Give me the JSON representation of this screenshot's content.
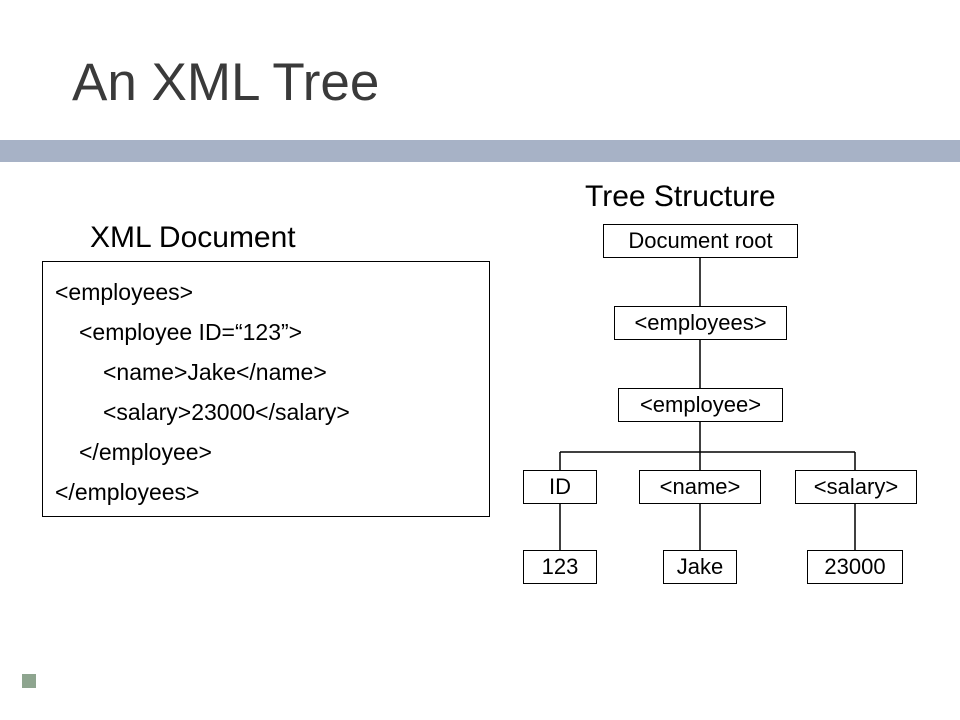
{
  "title": "An XML Tree",
  "left_heading": "XML Document",
  "right_heading": "Tree Structure",
  "xml_lines": {
    "l0": "<employees>",
    "l1": "<employee ID=“123”>",
    "l2": "<name>Jake</name>",
    "l3": "<salary>23000</salary>",
    "l4": "</employee>",
    "l5": "</employees>"
  },
  "tree": {
    "root": "Document root",
    "employees": "<employees>",
    "employee": "<employee>",
    "id_label": "ID",
    "name_label": "<name>",
    "salary_label": "<salary>",
    "id_value": "123",
    "name_value": "Jake",
    "salary_value": "23000"
  }
}
